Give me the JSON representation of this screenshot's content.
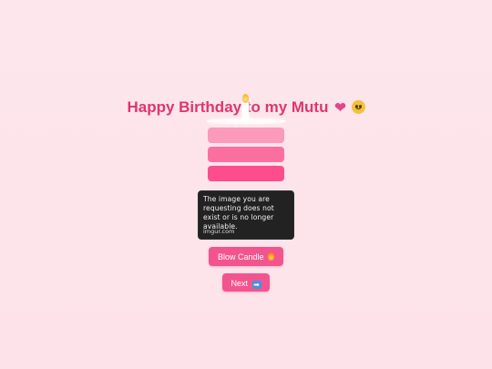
{
  "page": {
    "title_text": "Happy Birthday to my Mutu",
    "title_emojis": [
      "heart-icon",
      "pleading-face-icon"
    ]
  },
  "broken_image": {
    "message": "The image you are requesting does not exist or is no longer available.",
    "source": "imgur.com"
  },
  "buttons": {
    "blow_candle_label": "Blow Candle",
    "blow_candle_icon": "fire-icon",
    "next_label": "Next",
    "next_icon": "right-arrow-icon"
  },
  "colors": {
    "title": "#e0356e",
    "button": "#f2558e",
    "cake_layer_1": "#fb9abb",
    "cake_layer_2": "#fb6f9f",
    "cake_layer_3": "#fd4d8b"
  }
}
